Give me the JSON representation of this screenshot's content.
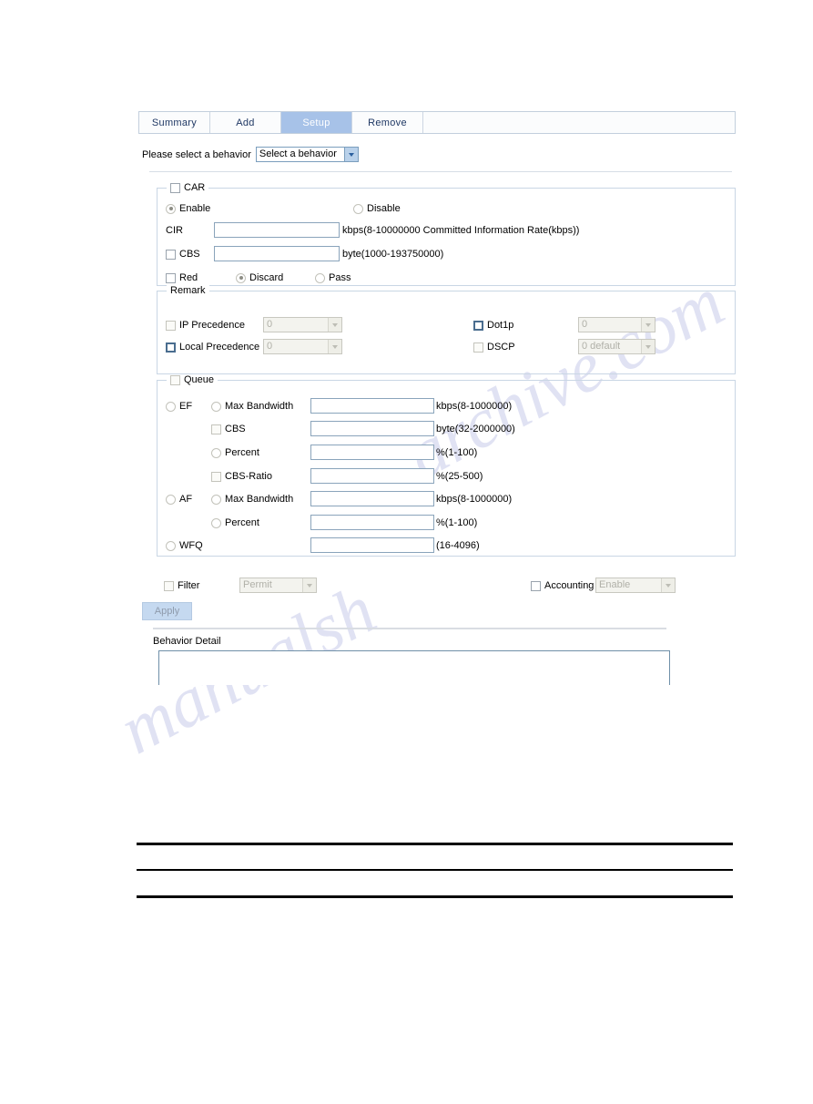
{
  "tabs": [
    {
      "label": "Summary",
      "active": false
    },
    {
      "label": "Add",
      "active": false
    },
    {
      "label": "Setup",
      "active": true
    },
    {
      "label": "Remove",
      "active": false
    }
  ],
  "behavior_select": {
    "label": "Please select a behavior",
    "value": "Select a behavior"
  },
  "car": {
    "legend": "CAR",
    "enable_label": "Enable",
    "disable_label": "Disable",
    "cir_label": "CIR",
    "cir_value": "",
    "cir_unit": "kbps(8-10000000 Committed Information Rate(kbps))",
    "cbs_label": "CBS",
    "cbs_value": "",
    "cbs_unit": "byte(1000-193750000)",
    "red_label": "Red",
    "discard_label": "Discard",
    "pass_label": "Pass"
  },
  "remark": {
    "legend": "Remark",
    "ip_precedence_label": "IP Precedence",
    "ip_precedence_value": "0",
    "local_precedence_label": "Local Precedence",
    "local_precedence_value": "0",
    "dot1p_label": "Dot1p",
    "dot1p_value": "0",
    "dscp_label": "DSCP",
    "dscp_value": "0 default"
  },
  "queue": {
    "legend": "Queue",
    "ef_label": "EF",
    "af_label": "AF",
    "wfq_label": "WFQ",
    "rows": [
      {
        "name": "ef-max-bandwidth",
        "label": "Max Bandwidth",
        "control": "radio",
        "value": "",
        "unit": "kbps(8-1000000)"
      },
      {
        "name": "ef-cbs",
        "label": "CBS",
        "control": "checkbox",
        "value": "",
        "unit": "byte(32-2000000)"
      },
      {
        "name": "ef-percent",
        "label": "Percent",
        "control": "radio",
        "value": "",
        "unit": "%(1-100)"
      },
      {
        "name": "ef-cbs-ratio",
        "label": "CBS-Ratio",
        "control": "checkbox",
        "value": "",
        "unit": "%(25-500)"
      },
      {
        "name": "af-max-bandwidth",
        "label": "Max Bandwidth",
        "control": "radio",
        "value": "",
        "unit": "kbps(8-1000000)"
      },
      {
        "name": "af-percent",
        "label": "Percent",
        "control": "radio",
        "value": "",
        "unit": "%(1-100)"
      },
      {
        "name": "wfq-queue-number",
        "label": "",
        "control": "none",
        "value": "",
        "unit": "(16-4096)"
      }
    ]
  },
  "footer": {
    "filter_label": "Filter",
    "filter_value": "Permit",
    "accounting_label": "Accounting",
    "accounting_value": "Enable",
    "apply_label": "Apply",
    "behavior_detail_label": "Behavior Detail",
    "behavior_detail_value": ""
  },
  "watermark": {
    "line1": "archive.com",
    "line2": "manualsh"
  }
}
